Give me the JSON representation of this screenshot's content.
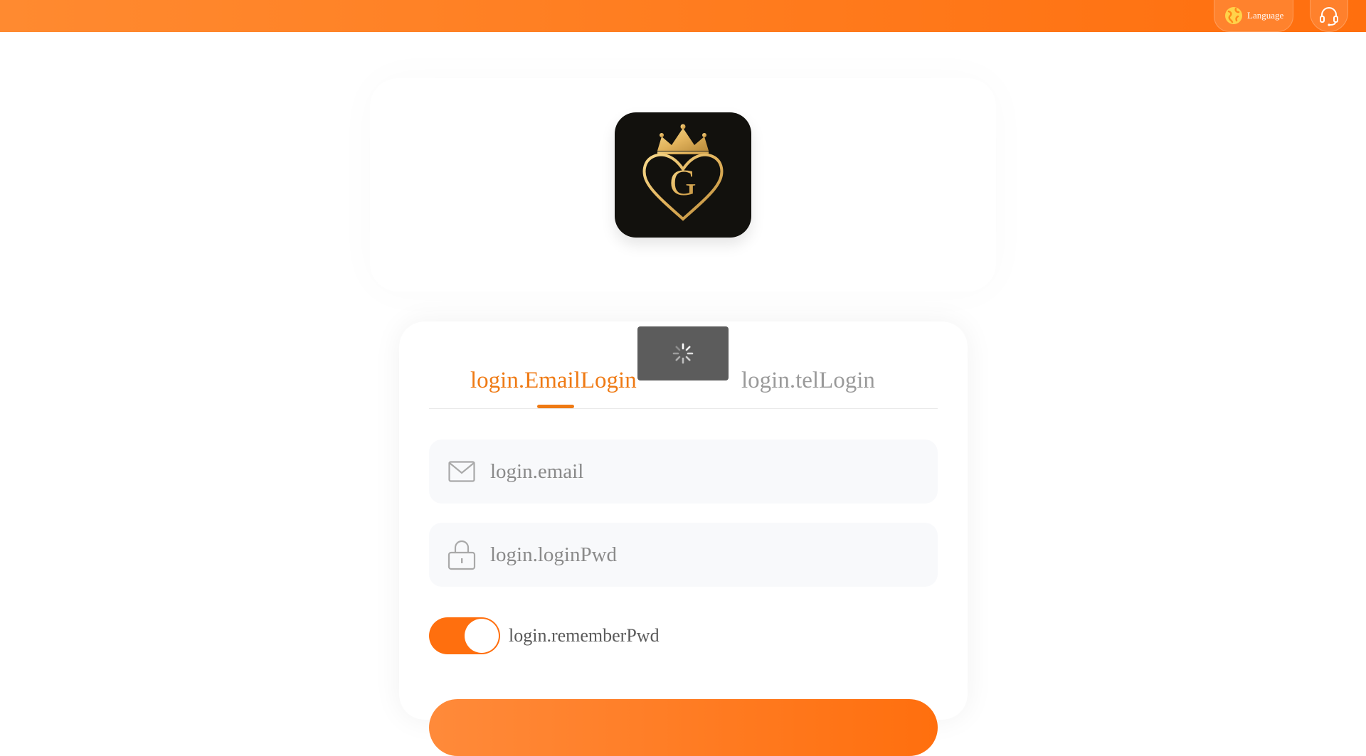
{
  "header": {
    "language_label": "Language",
    "language_icon": "globe-icon",
    "support_icon": "headset-icon"
  },
  "logo": {
    "letter": "G",
    "icons": [
      "crown-icon",
      "heart-icon"
    ]
  },
  "tabs": [
    {
      "label": "login.EmailLogin",
      "active": true
    },
    {
      "label": "login.telLogin",
      "active": false
    }
  ],
  "form": {
    "email_placeholder": "login.email",
    "email_icon": "mail-icon",
    "password_placeholder": "login.loginPwd",
    "password_icon": "lock-icon",
    "remember_label": "login.rememberPwd",
    "remember_on": true
  },
  "colors": {
    "accent": "#ff6f0e",
    "active_tab": "#ef7a14",
    "inactive_tab": "#9a9a9a",
    "logo_gold": "#e2b35c",
    "logo_bg": "#12110d"
  }
}
